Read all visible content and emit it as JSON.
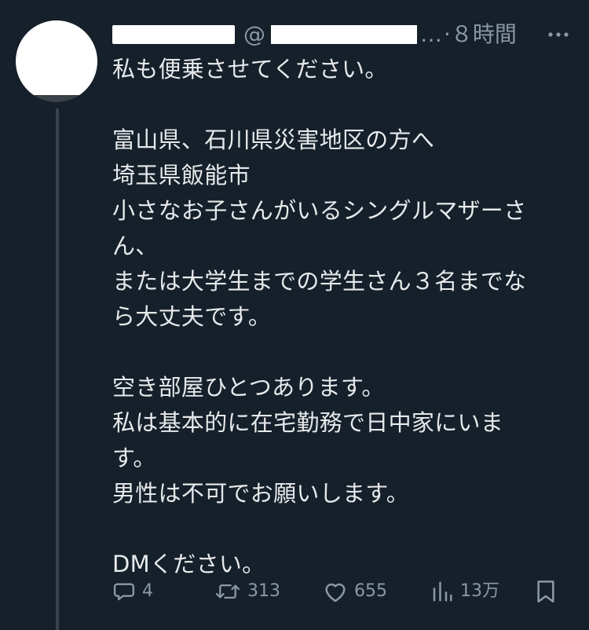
{
  "header": {
    "at_sign": "@",
    "ellipsis": "…",
    "time": "·８時間"
  },
  "body": {
    "lines": [
      "私も便乗させてください。",
      "",
      "富山県、石川県災害地区の方へ",
      "埼玉県飯能市",
      "小さなお子さんがいるシングルマザーさ",
      "ん、",
      "または大学生までの学生さん３名までな",
      "ら大丈夫です。",
      "",
      "空き部屋ひとつあります。",
      "私は基本的に在宅勤務で日中家にいま",
      "す。",
      "男性は不可でお願いします。",
      "",
      "DMください。"
    ]
  },
  "actions": {
    "reply_count": "4",
    "retweet_count": "313",
    "like_count": "655",
    "view_count": "13万"
  },
  "colors": {
    "background": "#15202b",
    "text": "#e7e9ea",
    "secondary": "#8b98a5",
    "thread_line": "#38444d"
  },
  "icons": {
    "reply": "speech-bubble-icon",
    "retweet": "retweet-arrows-icon",
    "like": "heart-icon",
    "views": "bar-chart-icon",
    "bookmark": "bookmark-icon",
    "more": "more-dots-icon"
  }
}
